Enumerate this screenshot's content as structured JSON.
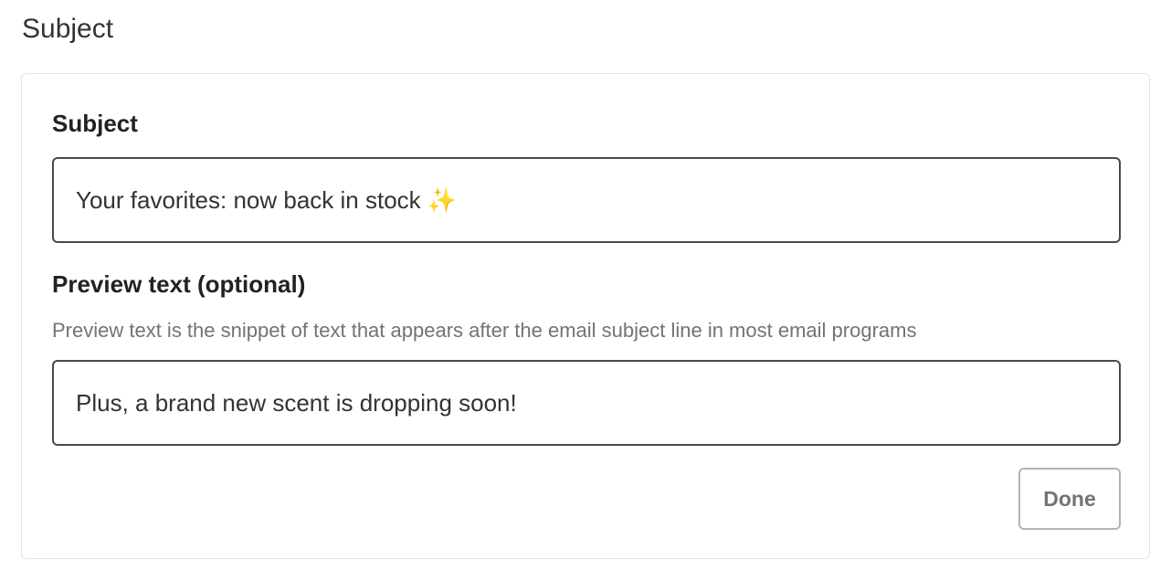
{
  "section": {
    "title": "Subject"
  },
  "form": {
    "subject": {
      "label": "Subject",
      "value": "Your favorites: now back in stock ✨"
    },
    "preview_text": {
      "label": "Preview text (optional)",
      "help": "Preview text is the snippet of text that appears after the email subject line in most email programs",
      "value": "Plus, a brand new scent is dropping soon!"
    },
    "done_label": "Done"
  }
}
